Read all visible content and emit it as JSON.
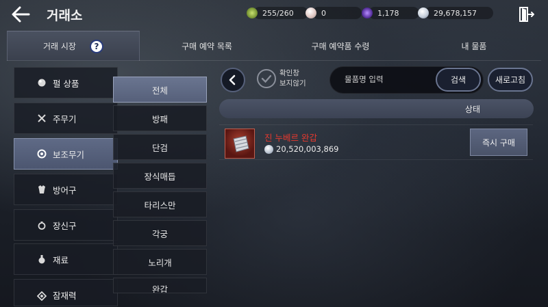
{
  "header": {
    "title": "거래소",
    "back_icon": "back-arrow-icon",
    "exit_icon": "exit-door-icon",
    "resources": [
      {
        "name": "energy",
        "value": "255/260",
        "color": "#8fb04a"
      },
      {
        "name": "pearl",
        "value": "0",
        "color": "#e8d4d0"
      },
      {
        "name": "dark-gem",
        "value": "1,178",
        "color": "#6a3fb0"
      },
      {
        "name": "silver",
        "value": "29,678,157",
        "color": "#c7d0dc"
      }
    ]
  },
  "tabs": [
    {
      "label": "거래 시장",
      "active": true
    },
    {
      "label": "구매 예약 목록",
      "active": false
    },
    {
      "label": "구매 예약품 수령",
      "active": false
    },
    {
      "label": "내 물품",
      "active": false
    }
  ],
  "help_label": "?",
  "categories": [
    {
      "label": "펄 상품",
      "icon": "pearl-icon"
    },
    {
      "label": "주무기",
      "icon": "crossed-swords-icon"
    },
    {
      "label": "보조무기",
      "icon": "shield-ring-icon",
      "active": true
    },
    {
      "label": "방어구",
      "icon": "armor-icon"
    },
    {
      "label": "장신구",
      "icon": "ring-icon"
    },
    {
      "label": "재료",
      "icon": "potion-icon"
    },
    {
      "label": "잠재력",
      "icon": "diamond-icon"
    }
  ],
  "subcategories": [
    {
      "label": "전체",
      "active": true
    },
    {
      "label": "방패"
    },
    {
      "label": "단검"
    },
    {
      "label": "장식매듭"
    },
    {
      "label": "타리스만"
    },
    {
      "label": "각궁"
    },
    {
      "label": "노리개"
    },
    {
      "label": "완갑"
    }
  ],
  "search": {
    "hide_confirm_line1": "확인창",
    "hide_confirm_line2": "보지않기",
    "placeholder": "물품명 입력",
    "search_label": "검색",
    "refresh_label": "새로고침"
  },
  "table": {
    "status_header": "상태",
    "items": [
      {
        "name": "진 누베르 완갑",
        "price": "20,520,003,869",
        "buy_label": "즉시 구매",
        "name_color": "#e8392e"
      }
    ]
  }
}
